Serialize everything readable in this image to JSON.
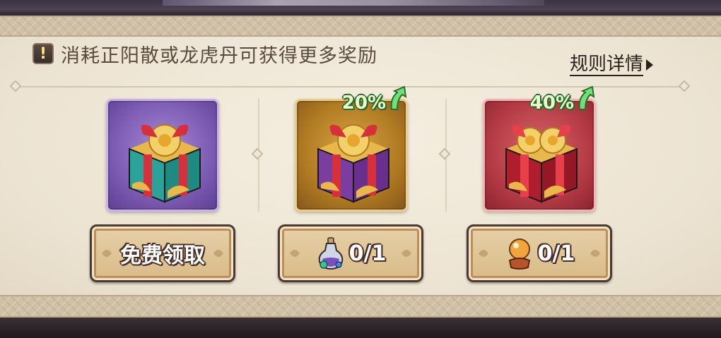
{
  "notice": {
    "text": "消耗正阳散或龙虎丹可获得更多奖励",
    "rules_link": "规则详情"
  },
  "rewards": [
    {
      "id": "free",
      "tier_color": "#7d5cb4",
      "boost": "",
      "button": {
        "icon": "none",
        "label": "免费领取"
      }
    },
    {
      "id": "zhengyang",
      "tier_color": "#b07a22",
      "boost": "20%",
      "button": {
        "icon": "potion-bottle-icon",
        "label": "0/1"
      }
    },
    {
      "id": "longhu",
      "tier_color": "#b53c46",
      "boost": "40%",
      "button": {
        "icon": "golden-orb-icon",
        "label": "0/1"
      }
    }
  ]
}
